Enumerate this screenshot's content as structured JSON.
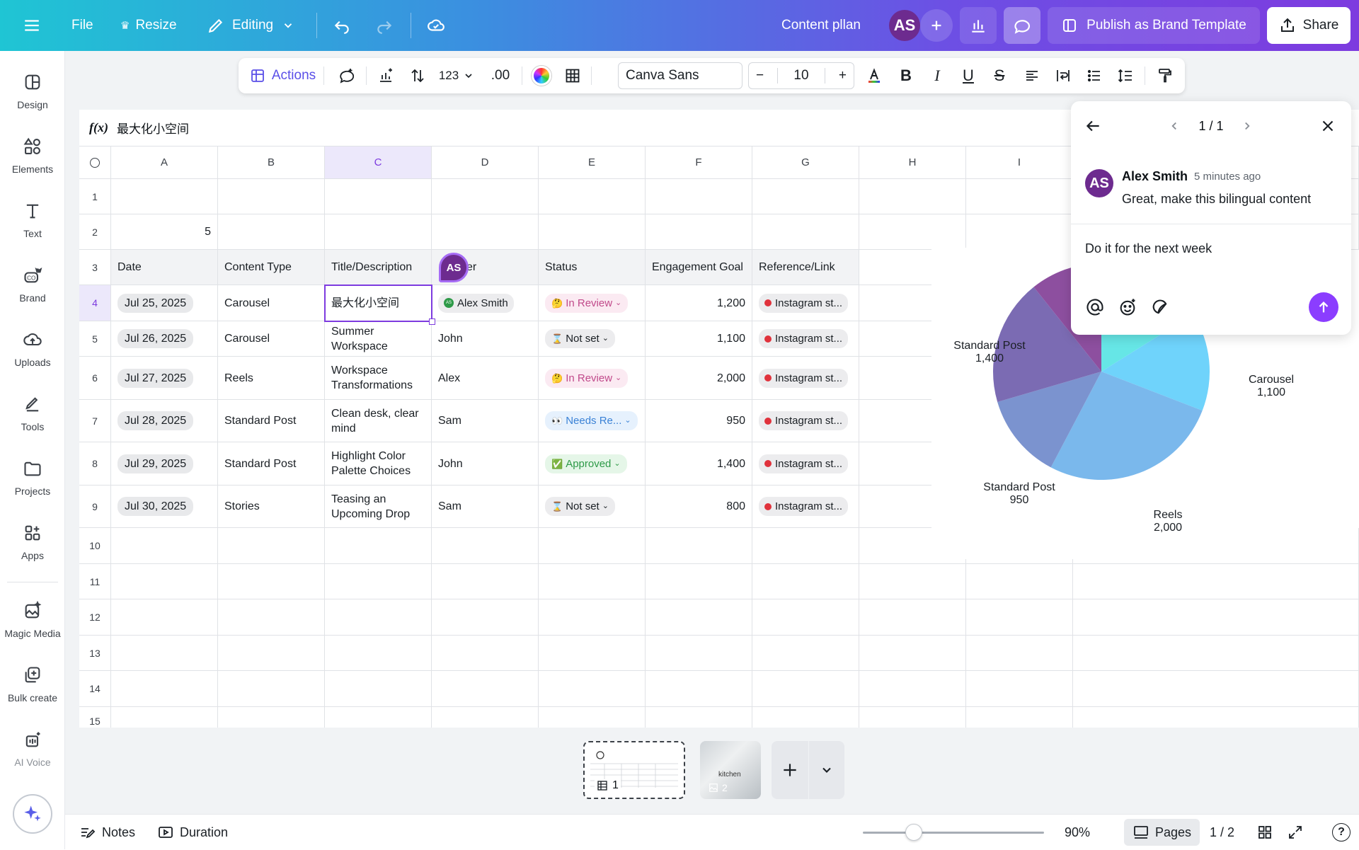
{
  "topbar": {
    "file": "File",
    "resize": "Resize",
    "editing": "Editing",
    "doc_title": "Content pllan",
    "avatar_initials": "AS",
    "publish_label": "Publish as Brand Template",
    "share_label": "Share"
  },
  "sidebar": {
    "items": [
      {
        "label": "Design",
        "icon": "design-icon"
      },
      {
        "label": "Elements",
        "icon": "elements-icon"
      },
      {
        "label": "Text",
        "icon": "text-icon"
      },
      {
        "label": "Brand",
        "icon": "brand-icon"
      },
      {
        "label": "Uploads",
        "icon": "uploads-icon"
      },
      {
        "label": "Tools",
        "icon": "tools-icon"
      },
      {
        "label": "Projects",
        "icon": "projects-icon"
      },
      {
        "label": "Apps",
        "icon": "apps-icon"
      },
      {
        "label": "Magic Media",
        "icon": "magic-media-icon"
      },
      {
        "label": "Bulk create",
        "icon": "bulk-create-icon"
      },
      {
        "label": "AI Voice",
        "icon": "ai-voice-icon"
      }
    ]
  },
  "toolbar": {
    "actions": "Actions",
    "number_format": "123",
    "decimals": ".00",
    "font": "Canva Sans",
    "font_size": "10",
    "minus": "−",
    "plus": "+",
    "bold": "B",
    "italic": "I",
    "underline": "U",
    "strike": "S"
  },
  "formula": {
    "label": "f(x)",
    "value": "最大化小空间"
  },
  "sheet": {
    "columns": [
      "A",
      "B",
      "C",
      "D",
      "E",
      "F",
      "G",
      "H",
      "I"
    ],
    "rows": [
      "1",
      "2",
      "3",
      "4",
      "5",
      "6",
      "7",
      "8",
      "9",
      "10",
      "11",
      "12",
      "13",
      "14",
      "15"
    ],
    "a2": "5",
    "headers": [
      "Date",
      "Content Type",
      "Title/Description",
      "Owner",
      "Status",
      "Engagement Goal",
      "Reference/Link"
    ],
    "owner_header_visible": "er",
    "data": [
      {
        "date": "Jul 25, 2025",
        "type": "Carousel",
        "title": "最大化小空间",
        "owner": "Alex Smith",
        "owner_badge": "AS",
        "status": "In Review",
        "status_icon": "🤔",
        "goal": "1,200",
        "link": "Instagram st..."
      },
      {
        "date": "Jul 26, 2025",
        "type": "Carousel",
        "title": "Summer Workspace",
        "owner": "John",
        "status": "Not set",
        "status_icon": "⌛",
        "goal": "1,100",
        "link": "Instagram st..."
      },
      {
        "date": "Jul 27, 2025",
        "type": "Reels",
        "title": "Workspace Transformations",
        "owner": "Alex",
        "status": "In Review",
        "status_icon": "🤔",
        "goal": "2,000",
        "link": "Instagram st..."
      },
      {
        "date": "Jul 28, 2025",
        "type": "Standard Post",
        "title": "Clean desk, clear mind",
        "owner": "Sam",
        "status": "Needs Re...",
        "status_icon": "👀",
        "goal": "950",
        "link": "Instagram st..."
      },
      {
        "date": "Jul 29, 2025",
        "type": "Standard Post",
        "title": "Highlight Color Palette Choices",
        "owner": "John",
        "status": "Approved",
        "status_icon": "✅",
        "goal": "1,400",
        "link": "Instagram st..."
      },
      {
        "date": "Jul 30, 2025",
        "type": "Stories",
        "title": "Teasing an Upcoming Drop",
        "owner": "Sam",
        "status": "Not set",
        "status_icon": "⌛",
        "goal": "800",
        "link": "Instagram st..."
      }
    ],
    "cursor_badge": "AS"
  },
  "chart_data": {
    "type": "pie",
    "categories": [
      "Carousel",
      "Carousel",
      "Reels",
      "Standard Post",
      "Standard Post",
      "Stories"
    ],
    "values": [
      1200,
      1100,
      2000,
      950,
      1400,
      800
    ],
    "visible_labels": [
      {
        "name": "Carousel",
        "value": "1,100"
      },
      {
        "name": "Reels",
        "value": "2,000"
      },
      {
        "name": "Standard Post",
        "value": "950"
      },
      {
        "name": "Standard Post",
        "value": "1,400"
      }
    ],
    "colors": [
      "#66e6e6",
      "#6fd3fb",
      "#7ab8ec",
      "#7b93cf",
      "#7b6bb3",
      "#8d4f9f"
    ]
  },
  "comment": {
    "pager": "1 / 1",
    "author_initials": "AS",
    "author": "Alex Smith",
    "time": "5 minutes ago",
    "text": "Great, make this bilingual content",
    "reply": "Do it for the next week"
  },
  "bottom": {
    "notes": "Notes",
    "duration": "Duration",
    "zoom": "90%",
    "zoom_fraction": 0.28,
    "pages": "Pages",
    "page_count": "1 / 2",
    "thumb1_num": "1",
    "thumb2_num": "2",
    "thumb2_text": "kitchen",
    "help": "?"
  },
  "colors": {
    "accent": "#8b3dff",
    "selection": "#7d3bdf"
  }
}
